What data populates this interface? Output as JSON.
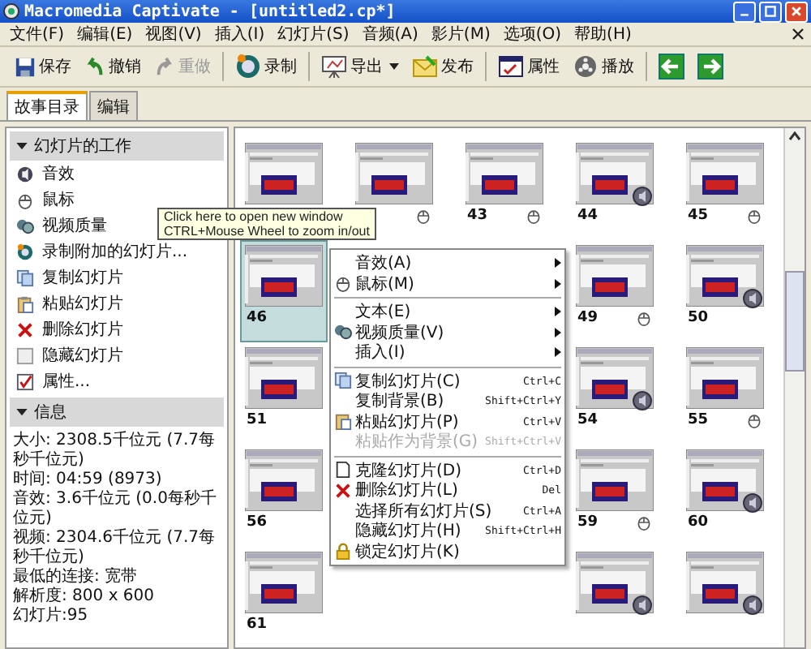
{
  "window": {
    "title": "Macromedia Captivate - [untitled2.cp*]"
  },
  "menu_bar": {
    "items": [
      "文件(F)",
      "编辑(E)",
      "视图(V)",
      "插入(I)",
      "幻灯片(S)",
      "音频(A)",
      "影片(M)",
      "选项(O)",
      "帮助(H)"
    ]
  },
  "toolbar": [
    {
      "kind": "save",
      "label": "保存",
      "disabled": false
    },
    {
      "kind": "undo",
      "label": "撤销",
      "disabled": false
    },
    {
      "kind": "redo",
      "label": "重做",
      "disabled": true
    },
    {
      "kind": "record",
      "label": "录制",
      "disabled": false
    },
    {
      "kind": "export",
      "label": "导出",
      "disabled": false
    },
    {
      "kind": "publish",
      "label": "发布",
      "disabled": false
    },
    {
      "kind": "properties",
      "label": "属性",
      "disabled": false
    },
    {
      "kind": "play",
      "label": "播放",
      "disabled": false
    },
    {
      "kind": "back"
    },
    {
      "kind": "forward"
    }
  ],
  "tabs": [
    {
      "label": "故事目录",
      "selected": true
    },
    {
      "label": "编辑",
      "selected": false
    }
  ],
  "slide_tasks": {
    "title": "幻灯片的工作",
    "expanded": true,
    "items": [
      {
        "kind": "sound",
        "label": "音效"
      },
      {
        "kind": "mouse",
        "label": "鼠标"
      },
      {
        "kind": "video",
        "label": "视频质量"
      },
      {
        "kind": "record",
        "label": "录制附加的幻灯片..."
      },
      {
        "kind": "copy",
        "label": "复制幻灯片"
      },
      {
        "kind": "paste",
        "label": "粘贴幻灯片"
      },
      {
        "kind": "delete",
        "label": "删除幻灯片"
      },
      {
        "kind": "hide",
        "label": "隐藏幻灯片"
      },
      {
        "kind": "properties",
        "label": "属性..."
      }
    ]
  },
  "info": {
    "title": "信息",
    "expanded": true,
    "lines": [
      "大小: 2308.5千位元 (7.7每秒千位元)",
      "时间: 04:59 (8973)",
      "音效: 3.6千位元 (0.0每秒千位元)",
      "视频: 2304.6千位元 (7.7每秒千位元)",
      "最低的连接: 宽带",
      "解析度: 800 x 600",
      "幻灯片:95"
    ]
  },
  "slide_rows": [
    [
      {
        "kind": "plain",
        "selected": false
      },
      {
        "kind": "mouse",
        "selected": false
      },
      {
        "label": "43",
        "kind": "mouse",
        "selected": false
      },
      {
        "label": "44",
        "kind": "sound",
        "selected": false
      },
      {
        "label": "45",
        "kind": "mouse",
        "selected": false
      }
    ],
    [
      {
        "label": "46",
        "kind": "plain",
        "selected": true
      },
      {
        "label": "49",
        "kind": "mouse",
        "selected": false
      },
      {
        "label": "50",
        "kind": "sound",
        "selected": false
      }
    ],
    [
      {
        "label": "51",
        "kind": "plain",
        "selected": false
      },
      {
        "label": "54",
        "kind": "sound",
        "selected": false
      },
      {
        "label": "55",
        "kind": "mouse",
        "selected": false
      }
    ],
    [
      {
        "label": "56",
        "kind": "plain",
        "selected": false
      },
      {
        "label": "59",
        "kind": "mouse",
        "selected": false
      },
      {
        "label": "60",
        "kind": "sound",
        "selected": false
      }
    ],
    [
      {
        "label": "61",
        "kind": "plain",
        "selected": false
      },
      {
        "kind": "sound",
        "selected": false
      },
      {
        "kind": "sound",
        "selected": false
      }
    ]
  ],
  "tooltip": {
    "lines": [
      "Click here to open new window",
      "CTRL+Mouse Wheel to zoom in/out"
    ]
  },
  "context_menu": [
    {
      "kind": "sound",
      "label": "音效(A)",
      "submenu": true,
      "disabled": false
    },
    {
      "kind": "mouse",
      "label": "鼠标(M)",
      "submenu": true,
      "disabled": false
    },
    {
      "kind": "separator"
    },
    {
      "kind": "text",
      "label": "文本(E)",
      "submenu": true,
      "disabled": false
    },
    {
      "kind": "video",
      "label": "视频质量(V)",
      "submenu": true,
      "disabled": false
    },
    {
      "kind": "insert",
      "label": "插入(I)",
      "submenu": true,
      "disabled": false
    },
    {
      "kind": "separator"
    },
    {
      "kind": "copy",
      "label": "复制幻灯片(C)",
      "shortcut": "Ctrl+C",
      "submenu": false,
      "disabled": false
    },
    {
      "kind": "copy_background",
      "label": "复制背景(B)",
      "shortcut": "Shift+Ctrl+Y",
      "submenu": false,
      "disabled": false
    },
    {
      "kind": "paste",
      "label": "粘贴幻灯片(P)",
      "shortcut": "Ctrl+V",
      "submenu": false,
      "disabled": false
    },
    {
      "kind": "paste_background",
      "label": "粘贴作为背景(G)",
      "shortcut": "Shift+Ctrl+V",
      "submenu": false,
      "disabled": true
    },
    {
      "kind": "separator"
    },
    {
      "kind": "clone",
      "label": "克隆幻灯片(D)",
      "shortcut": "Ctrl+D",
      "submenu": false,
      "disabled": false
    },
    {
      "kind": "delete",
      "label": "删除幻灯片(L)",
      "shortcut": "Del",
      "submenu": false,
      "disabled": false
    },
    {
      "kind": "select_all",
      "label": "选择所有幻灯片(S)",
      "shortcut": "Ctrl+A",
      "submenu": false,
      "disabled": false
    },
    {
      "kind": "hide",
      "label": "隐藏幻灯片(H)",
      "shortcut": "Shift+Ctrl+H",
      "submenu": false,
      "disabled": false
    },
    {
      "kind": "lock",
      "label": "锁定幻灯片(K)",
      "submenu": false,
      "disabled": false
    }
  ]
}
